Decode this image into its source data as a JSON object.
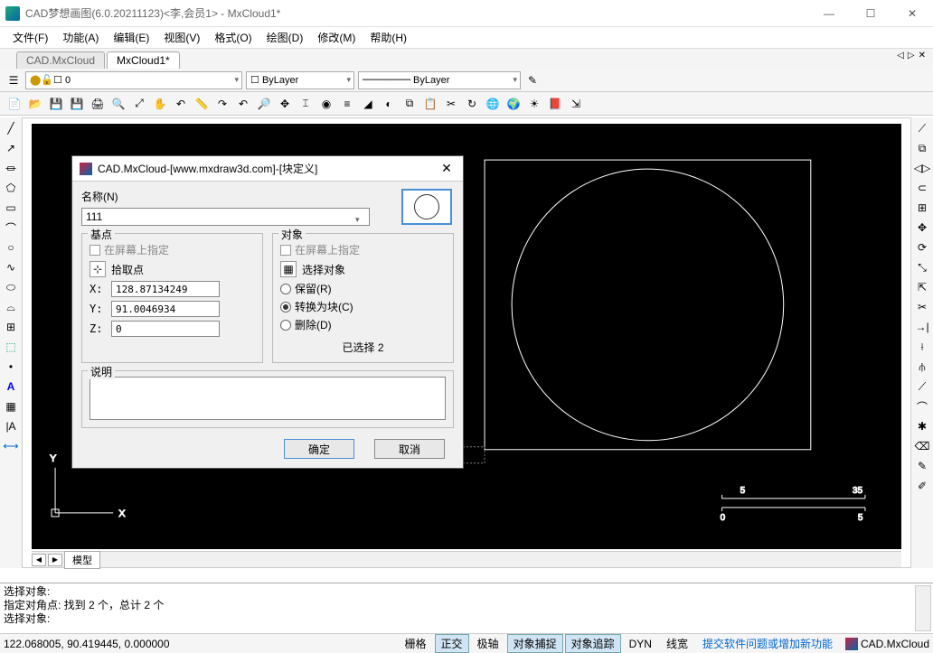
{
  "window": {
    "title": "CAD梦想画图(6.0.20211123)<李,会员1> - MxCloud1*"
  },
  "menu": [
    "文件(F)",
    "功能(A)",
    "编辑(E)",
    "视图(V)",
    "格式(O)",
    "绘图(D)",
    "修改(M)",
    "帮助(H)"
  ],
  "tabs": {
    "inactive": "CAD.MxCloud",
    "active": "MxCloud1*"
  },
  "props": {
    "layer": "0",
    "color": "ByLayer",
    "linetype": "ByLayer"
  },
  "model_tab": "模型",
  "cmd": {
    "l1": "选择对象:",
    "l2": "指定对角点:   找到 2 个，总计 2 个",
    "l3": "选择对象:"
  },
  "status": {
    "coords": "122.068005,  90.419445,  0.000000",
    "b1": "栅格",
    "b2": "正交",
    "b3": "极轴",
    "b4": "对象捕捉",
    "b5": "对象追踪",
    "b6": "DYN",
    "b7": "线宽",
    "link": "提交软件问题或增加新功能",
    "brand": "CAD.MxCloud"
  },
  "dialog": {
    "title": "CAD.MxCloud-[www.mxdraw3d.com]-[块定义]",
    "name_label": "名称(N)",
    "name_value": "111",
    "base": {
      "title": "基点",
      "onscreen": "在屏幕上指定",
      "pick": "拾取点",
      "x": "128.87134249",
      "y": "91.0046934",
      "z": "0"
    },
    "obj": {
      "title": "对象",
      "onscreen": "在屏幕上指定",
      "select": "选择对象",
      "r1": "保留(R)",
      "r2": "转换为块(C)",
      "r3": "删除(D)",
      "count": "已选择 2"
    },
    "desc_label": "说明",
    "ok": "确定",
    "cancel": "取消"
  },
  "scale": {
    "left": "5",
    "right": "35",
    "left2": "0",
    "right2": "5"
  }
}
